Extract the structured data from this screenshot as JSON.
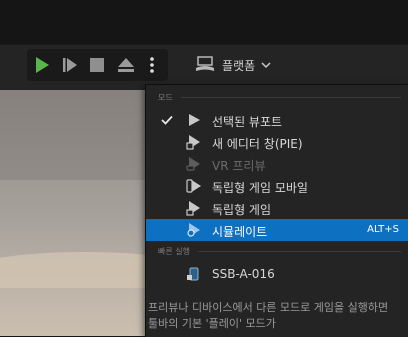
{
  "toolbar": {
    "platform_label": "플랫폼",
    "icons": [
      "play-icon",
      "step-icon",
      "stop-icon",
      "eject-icon",
      "more-vertical-icon",
      "platform-gamepad-icon",
      "chevron-down-icon"
    ]
  },
  "menu": {
    "section_modes": "모드",
    "items": [
      {
        "label": "선택된 뷰포트",
        "checked": true,
        "enabled": true
      },
      {
        "label": "새 에디터 창(PIE)",
        "enabled": true
      },
      {
        "label": "VR 프리뷰",
        "enabled": false
      },
      {
        "label": "독립형 게임 모바일",
        "enabled": true
      },
      {
        "label": "독립형 게임",
        "enabled": true
      },
      {
        "label": "시뮬레이트",
        "enabled": true,
        "highlighted": true,
        "shortcut": "ALT+S"
      }
    ],
    "section_quick": "빠른 실행",
    "quick_items": [
      {
        "label": "SSB-A-016"
      }
    ],
    "hint": "프리뷰나 디바이스에서 다른 모드로 게임을 실행하면 툴바의 기본 '플레이' 모드가"
  },
  "colors": {
    "accent": "#0e70c0",
    "play_green": "#58b74a",
    "menu_bg": "#242424",
    "toolbar_bg": "#242424"
  }
}
